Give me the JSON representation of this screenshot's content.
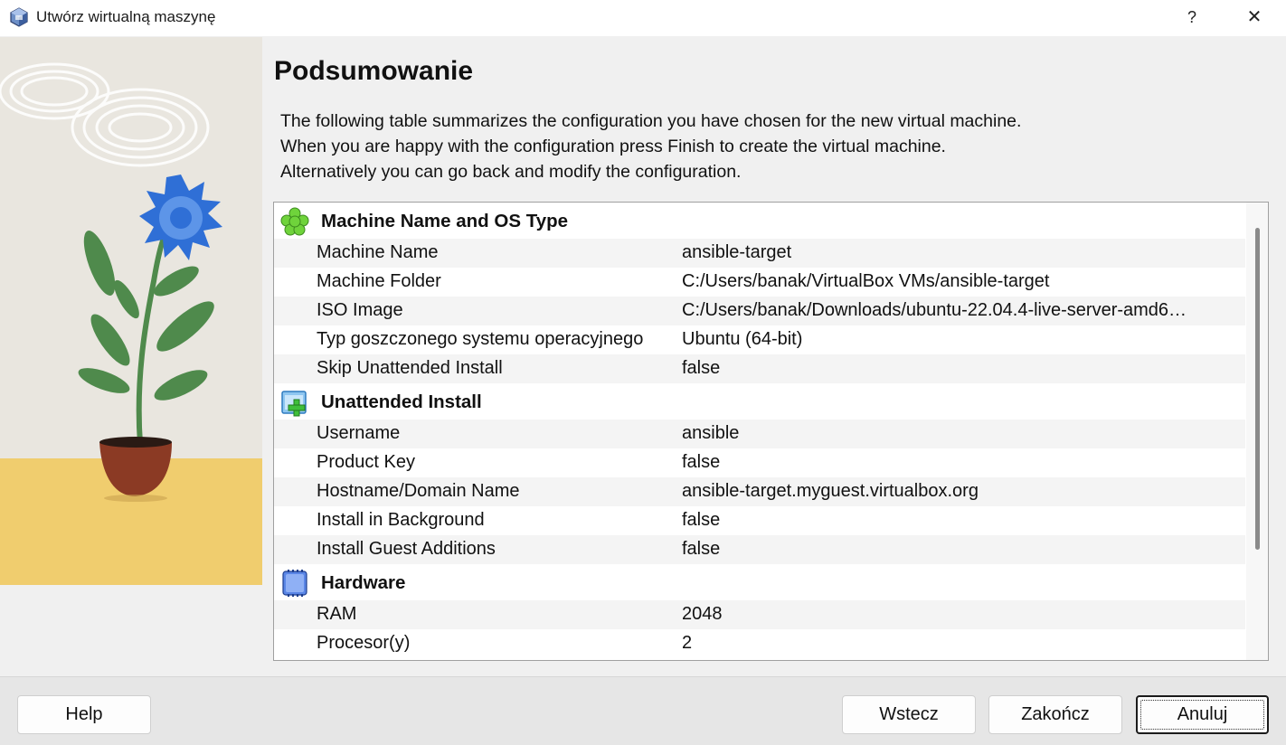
{
  "window": {
    "title": "Utwórz wirtualną maszynę",
    "help_glyph": "?",
    "close_glyph": "✕"
  },
  "page": {
    "title": "Podsumowanie",
    "description": [
      "The following table summarizes the configuration you have chosen for the new virtual machine.",
      "When you are happy with the configuration press Finish to create the virtual machine.",
      "Alternatively you can go back and modify the configuration."
    ]
  },
  "summary": {
    "sections": [
      {
        "title": "Machine Name and OS Type",
        "icon": "os-type-icon",
        "rows": [
          {
            "key": "Machine Name",
            "value": "ansible-target"
          },
          {
            "key": "Machine Folder",
            "value": "C:/Users/banak/VirtualBox VMs/ansible-target"
          },
          {
            "key": "ISO Image",
            "value": "C:/Users/banak/Downloads/ubuntu-22.04.4-live-server-amd6…"
          },
          {
            "key": "Typ goszczonego systemu operacyjnego",
            "value": "Ubuntu (64-bit)"
          },
          {
            "key": "Skip Unattended Install",
            "value": "false"
          }
        ]
      },
      {
        "title": "Unattended Install",
        "icon": "unattended-install-icon",
        "rows": [
          {
            "key": "Username",
            "value": "ansible"
          },
          {
            "key": "Product Key",
            "value": "false"
          },
          {
            "key": "Hostname/Domain Name",
            "value": "ansible-target.myguest.virtualbox.org"
          },
          {
            "key": "Install in Background",
            "value": "false"
          },
          {
            "key": "Install Guest Additions",
            "value": "false"
          }
        ]
      },
      {
        "title": "Hardware",
        "icon": "hardware-chip-icon",
        "rows": [
          {
            "key": "RAM",
            "value": "2048"
          },
          {
            "key": "Procesor(y)",
            "value": "2"
          }
        ]
      }
    ]
  },
  "buttons": {
    "help": "Help",
    "back": "Wstecz",
    "finish": "Zakończ",
    "cancel": "Anuluj"
  },
  "colors": {
    "accent_blue": "#2f6fd6",
    "leaf_green": "#4f8a4c",
    "pot_red": "#8b3a24",
    "ground_yellow": "#f0cd6e"
  }
}
